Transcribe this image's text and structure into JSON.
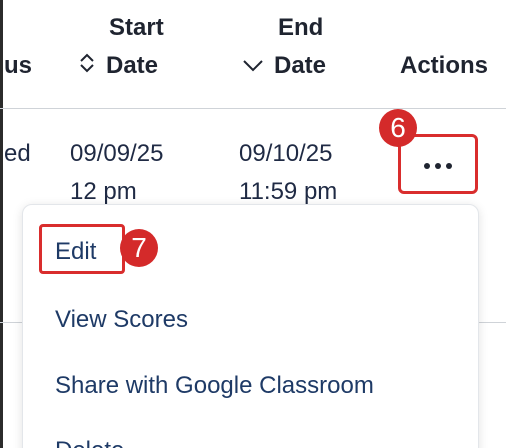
{
  "table": {
    "headers": {
      "status_partial": "us",
      "start_date_top": "Start",
      "start_date_bottom": "Date",
      "end_date_top": "End",
      "end_date_bottom": "Date",
      "actions": "Actions"
    },
    "row": {
      "status_partial": "ed",
      "start_date": "09/09/25",
      "start_time": "12 pm",
      "end_date": "09/10/25",
      "end_time": "11:59 pm"
    }
  },
  "callouts": {
    "actions_badge": "6",
    "edit_badge": "7"
  },
  "menu": {
    "items": [
      {
        "label": "Edit"
      },
      {
        "label": "View Scores"
      },
      {
        "label": "Share with Google Classroom"
      },
      {
        "label": "Delete"
      }
    ]
  },
  "icons": {
    "start_sort": "sort-updown-icon",
    "end_sort": "chevron-down-icon",
    "actions": "more-horizontal-icon"
  },
  "colors": {
    "callout_red": "#d42a2a",
    "menu_text": "#1e3a66",
    "header_text": "#1f2430"
  }
}
